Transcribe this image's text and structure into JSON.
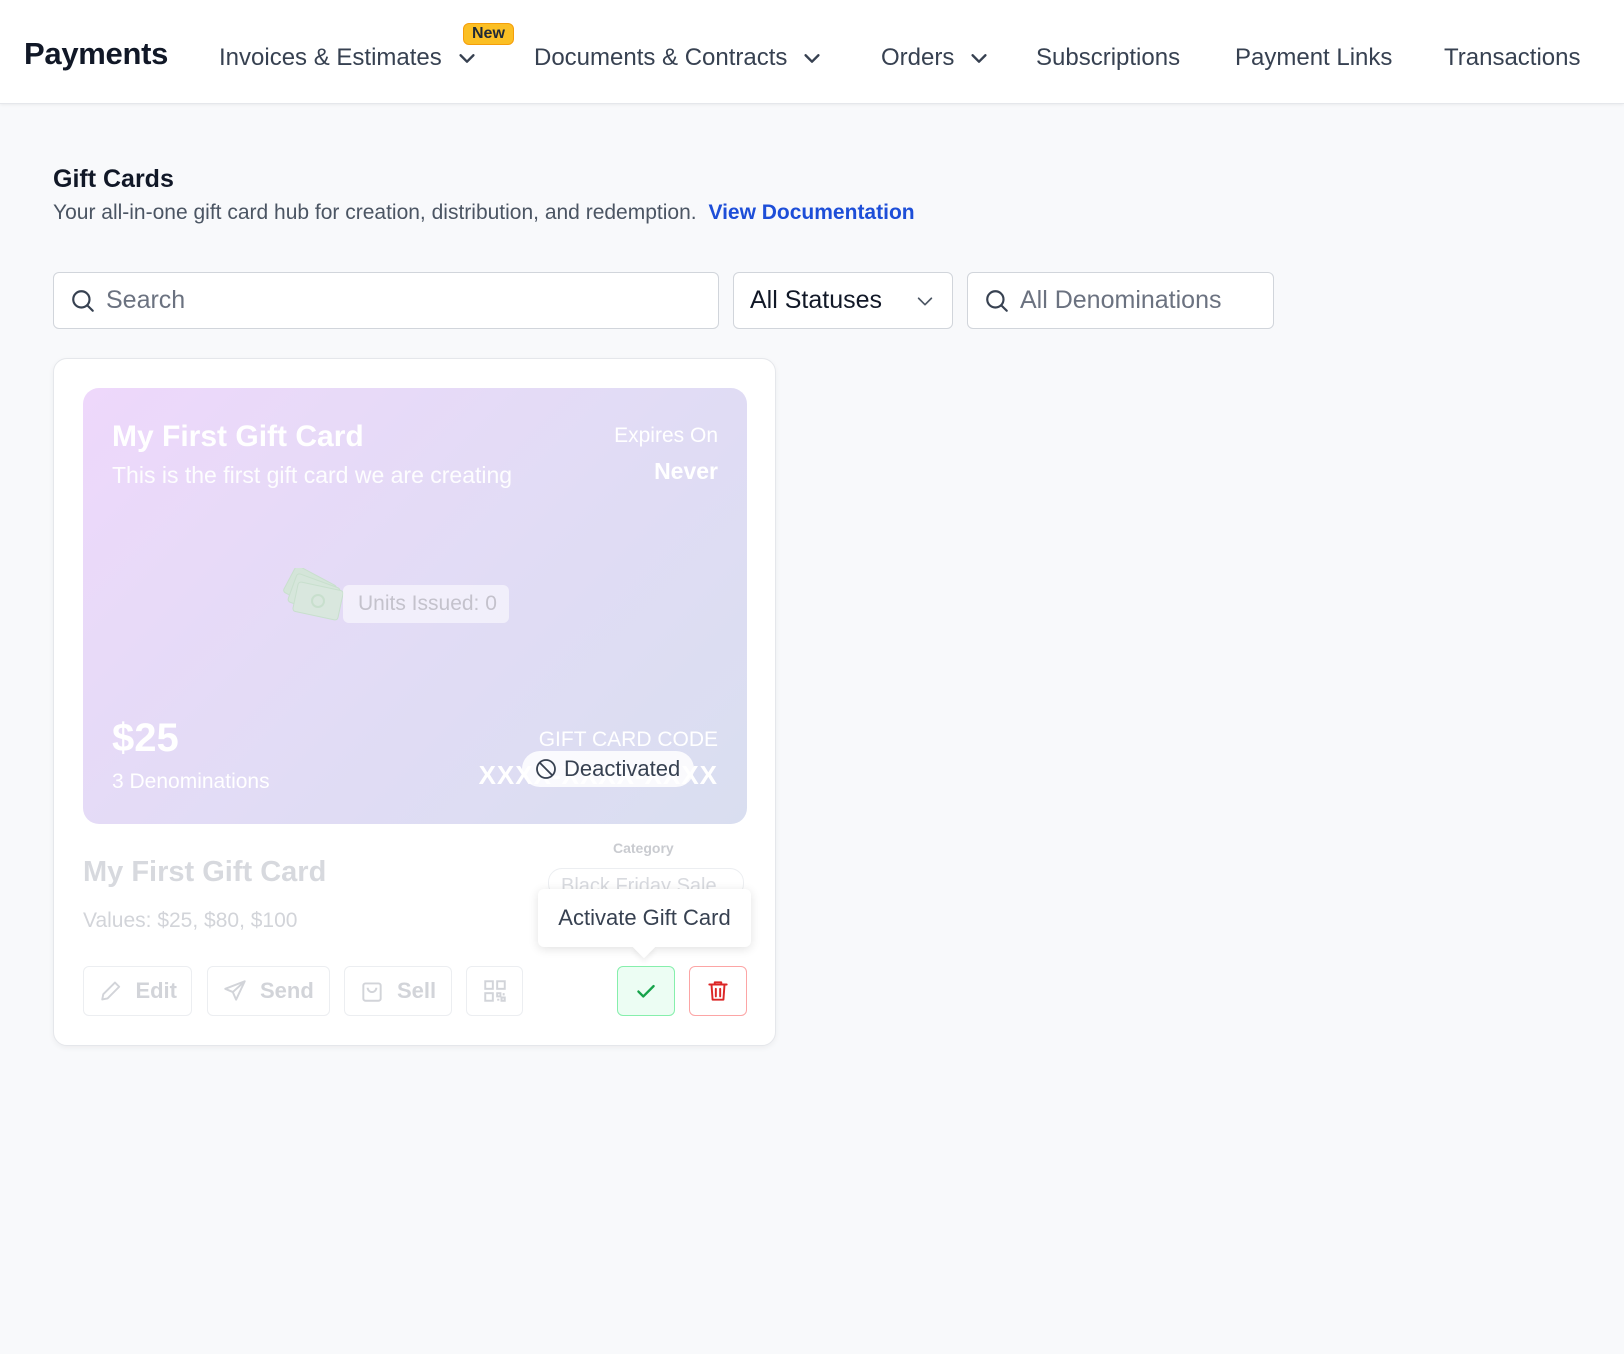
{
  "nav": {
    "brand": "Payments",
    "items": [
      {
        "label": "Invoices & Estimates",
        "has_dropdown": true,
        "badge": "New"
      },
      {
        "label": "Documents & Contracts",
        "has_dropdown": true
      },
      {
        "label": "Orders",
        "has_dropdown": true
      },
      {
        "label": "Subscriptions",
        "has_dropdown": false
      },
      {
        "label": "Payment Links",
        "has_dropdown": false
      },
      {
        "label": "Transactions",
        "has_dropdown": false
      }
    ]
  },
  "page": {
    "title": "Gift Cards",
    "subtitle": "Your all-in-one gift card hub for creation, distribution, and redemption.",
    "doc_link": "View Documentation"
  },
  "filters": {
    "search_placeholder": "Search",
    "status_selected": "All Statuses",
    "denominations_placeholder": "All Denominations"
  },
  "gift_card": {
    "title": "My First Gift Card",
    "description": "This is the first gift card we are creating",
    "expires_label": "Expires On",
    "expires_value": "Never",
    "units_issued": "Units Issued: 0",
    "amount": "$25",
    "denominations": "3 Denominations",
    "code_label": "GIFT CARD CODE",
    "code_value": "XXXX-XXXX-XXXX",
    "status": "Deactivated",
    "name": "My First Gift Card",
    "values": "Values: $25, $80, $100",
    "category_label": "Category",
    "category_value": "Black Friday Sale"
  },
  "actions": {
    "edit": "Edit",
    "send": "Send",
    "sell": "Sell",
    "tooltip": "Activate Gift Card"
  },
  "colors": {
    "link": "#1d4ed8",
    "badge": "#fbbf24",
    "activate_border": "#86efac",
    "activate_check": "#16a34a",
    "delete": "#dc2626"
  }
}
